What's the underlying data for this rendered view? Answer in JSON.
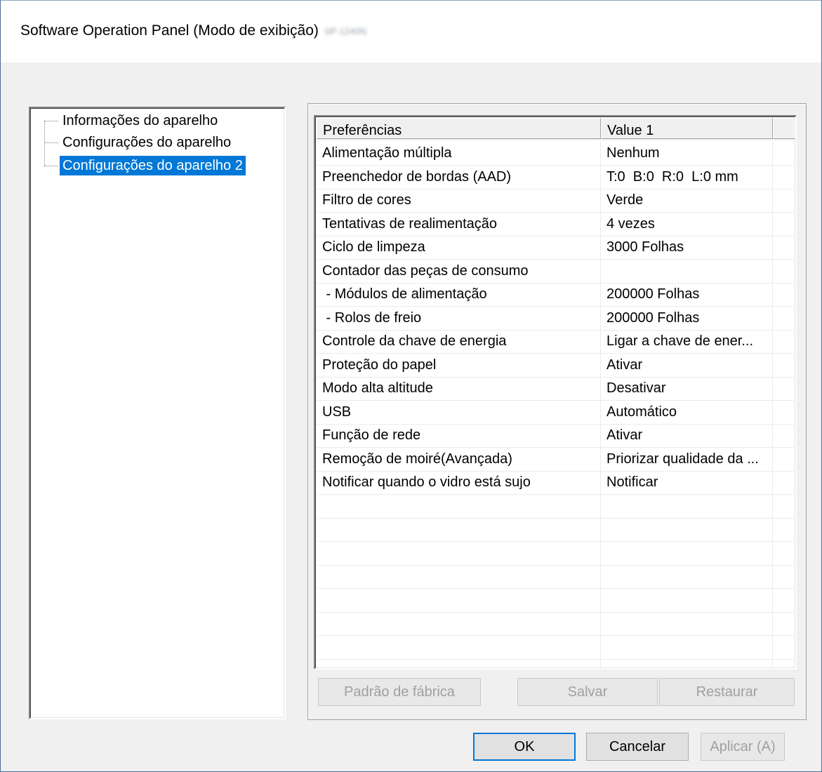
{
  "window": {
    "title": "Software Operation Panel (Modo de exibição)",
    "model": "SP-1240N"
  },
  "tree": {
    "items": [
      {
        "label": "Informações do aparelho",
        "selected": false
      },
      {
        "label": "Configurações do aparelho",
        "selected": false
      },
      {
        "label": "Configurações do aparelho 2",
        "selected": true
      }
    ]
  },
  "table": {
    "columns": [
      "Preferências",
      "Value 1"
    ],
    "rows": [
      [
        "Alimentação múltipla",
        "Nenhum"
      ],
      [
        "Preenchedor de bordas (AAD)",
        "T:0  B:0  R:0  L:0 mm"
      ],
      [
        "Filtro de cores",
        "Verde"
      ],
      [
        "Tentativas de realimentação",
        "4 vezes"
      ],
      [
        "Ciclo de limpeza",
        "3000 Folhas"
      ],
      [
        "Contador das peças de consumo",
        ""
      ],
      [
        " - Módulos de alimentação",
        "200000 Folhas"
      ],
      [
        " - Rolos de freio",
        "200000 Folhas"
      ],
      [
        "Controle da chave de energia",
        "Ligar a chave de ener..."
      ],
      [
        "Proteção do papel",
        "Ativar"
      ],
      [
        "Modo alta altitude",
        "Desativar"
      ],
      [
        "USB",
        "Automático"
      ],
      [
        "Função de rede",
        "Ativar"
      ],
      [
        "Remoção de moiré(Avançada)",
        "Priorizar qualidade da ..."
      ],
      [
        "Notificar quando o vidro está sujo",
        "Notificar"
      ]
    ]
  },
  "group_buttons": {
    "factory_default": "Padrão de fábrica",
    "save": "Salvar",
    "restore": "Restaurar"
  },
  "dialog_buttons": {
    "ok": "OK",
    "cancel": "Cancelar",
    "apply": "Aplicar (A)"
  }
}
